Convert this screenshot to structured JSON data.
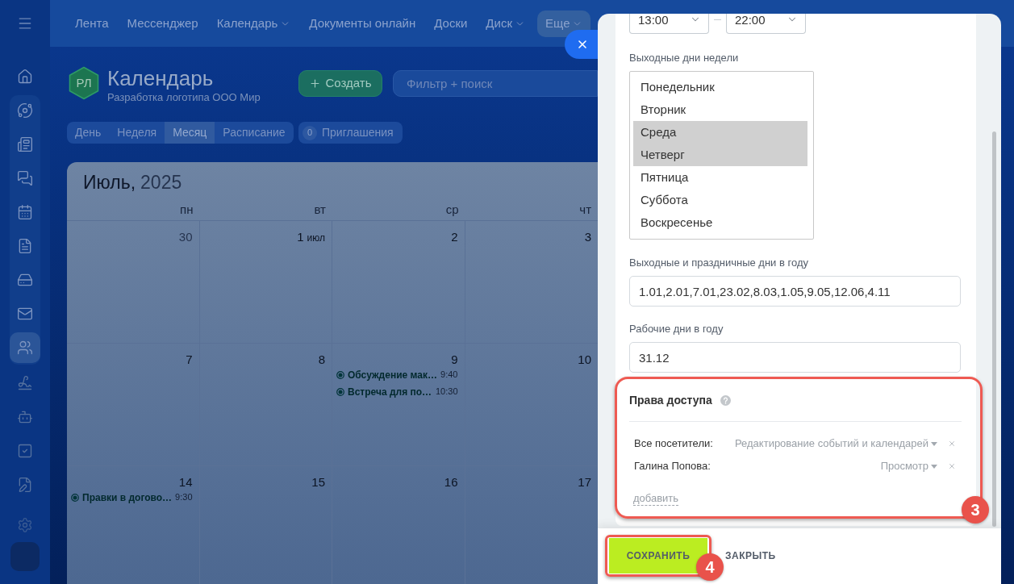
{
  "sidebar": {
    "items": [
      {
        "selected": false
      },
      {
        "selected": false
      },
      {
        "selected": false
      },
      {
        "selected": false
      },
      {
        "selected": false
      },
      {
        "selected": false
      },
      {
        "selected": false
      },
      {
        "selected": false
      },
      {
        "selected": true
      },
      {
        "selected": false
      },
      {
        "selected": false
      },
      {
        "selected": false
      },
      {
        "selected": false
      }
    ]
  },
  "top_nav": {
    "items": [
      {
        "label": "Лента",
        "dropdown": false,
        "selected": false
      },
      {
        "label": "Мессенджер",
        "dropdown": false,
        "selected": false
      },
      {
        "label": "Календарь",
        "dropdown": true,
        "selected": false
      },
      {
        "label": "Документы онлайн",
        "dropdown": false,
        "selected": false
      },
      {
        "label": "Доски",
        "dropdown": false,
        "selected": false
      },
      {
        "label": "Диск",
        "dropdown": true,
        "selected": false
      },
      {
        "label": "Еще",
        "dropdown": true,
        "selected": true
      }
    ]
  },
  "header": {
    "logo": "РЛ",
    "title": "Календарь",
    "subtitle": "Разработка логотипа ООО Мир",
    "create_button": "Создать",
    "search": {
      "placeholder": "Фильтр + поиск"
    }
  },
  "view_tabs": [
    {
      "label": "День",
      "selected": false
    },
    {
      "label": "Неделя",
      "selected": false
    },
    {
      "label": "Месяц",
      "selected": true
    },
    {
      "label": "Расписание",
      "selected": false
    }
  ],
  "invitations": {
    "count": "0",
    "label": "Приглашения"
  },
  "calendar": {
    "month": "Июль,",
    "year": "2025",
    "weekdays": [
      "пн",
      "вт",
      "ср",
      "чт"
    ],
    "weeks": [
      [
        {
          "day": "30",
          "muted": true
        },
        {
          "day": "1",
          "month": "июл",
          "muted": false
        },
        {
          "day": "2",
          "muted": false
        },
        {
          "day": "3",
          "muted": false
        }
      ],
      [
        {
          "day": "7",
          "muted": false
        },
        {
          "day": "8",
          "muted": false
        },
        {
          "day": "9",
          "muted": false,
          "events": [
            {
              "title": "Обсуждение мак…",
              "time": "9:40"
            },
            {
              "title": "Встреча для по…",
              "time": "10:30"
            }
          ]
        },
        {
          "day": "10",
          "muted": false
        }
      ],
      [
        {
          "day": "14",
          "muted": false,
          "events": [
            {
              "title": "Правки в догово…",
              "time": "9:30"
            }
          ]
        },
        {
          "day": "15",
          "muted": false
        },
        {
          "day": "16",
          "muted": false
        },
        {
          "day": "17",
          "muted": false
        }
      ]
    ]
  },
  "panel": {
    "work_hours": {
      "from": "13:00",
      "to": "22:00"
    },
    "weekend_days": {
      "label": "Выходные дни недели",
      "options": [
        {
          "label": "Понедельник",
          "selected": false
        },
        {
          "label": "Вторник",
          "selected": false
        },
        {
          "label": "Среда",
          "selected": true
        },
        {
          "label": "Четверг",
          "selected": true
        },
        {
          "label": "Пятница",
          "selected": false
        },
        {
          "label": "Суббота",
          "selected": false
        },
        {
          "label": "Воскресенье",
          "selected": false
        }
      ]
    },
    "holidays": {
      "label": "Выходные и праздничные дни в году",
      "value": "1.01,2.01,7.01,23.02,8.03,1.05,9.05,12.06,4.11"
    },
    "workdays": {
      "label": "Рабочие дни в году",
      "value": "31.12"
    },
    "access": {
      "title": "Права доступа",
      "rows": [
        {
          "name": "Все посетители:",
          "permission": "Редактирование событий и календарей"
        },
        {
          "name": "Галина Попова:",
          "permission": "Просмотр"
        }
      ],
      "add_link": "добавить",
      "callout": "3"
    },
    "footer": {
      "buttons": [
        {
          "label": "СОХРАНИТЬ",
          "kind": "primary"
        },
        {
          "label": "ЗАКРЫТЬ",
          "kind": "link"
        }
      ],
      "callout": "4"
    }
  }
}
